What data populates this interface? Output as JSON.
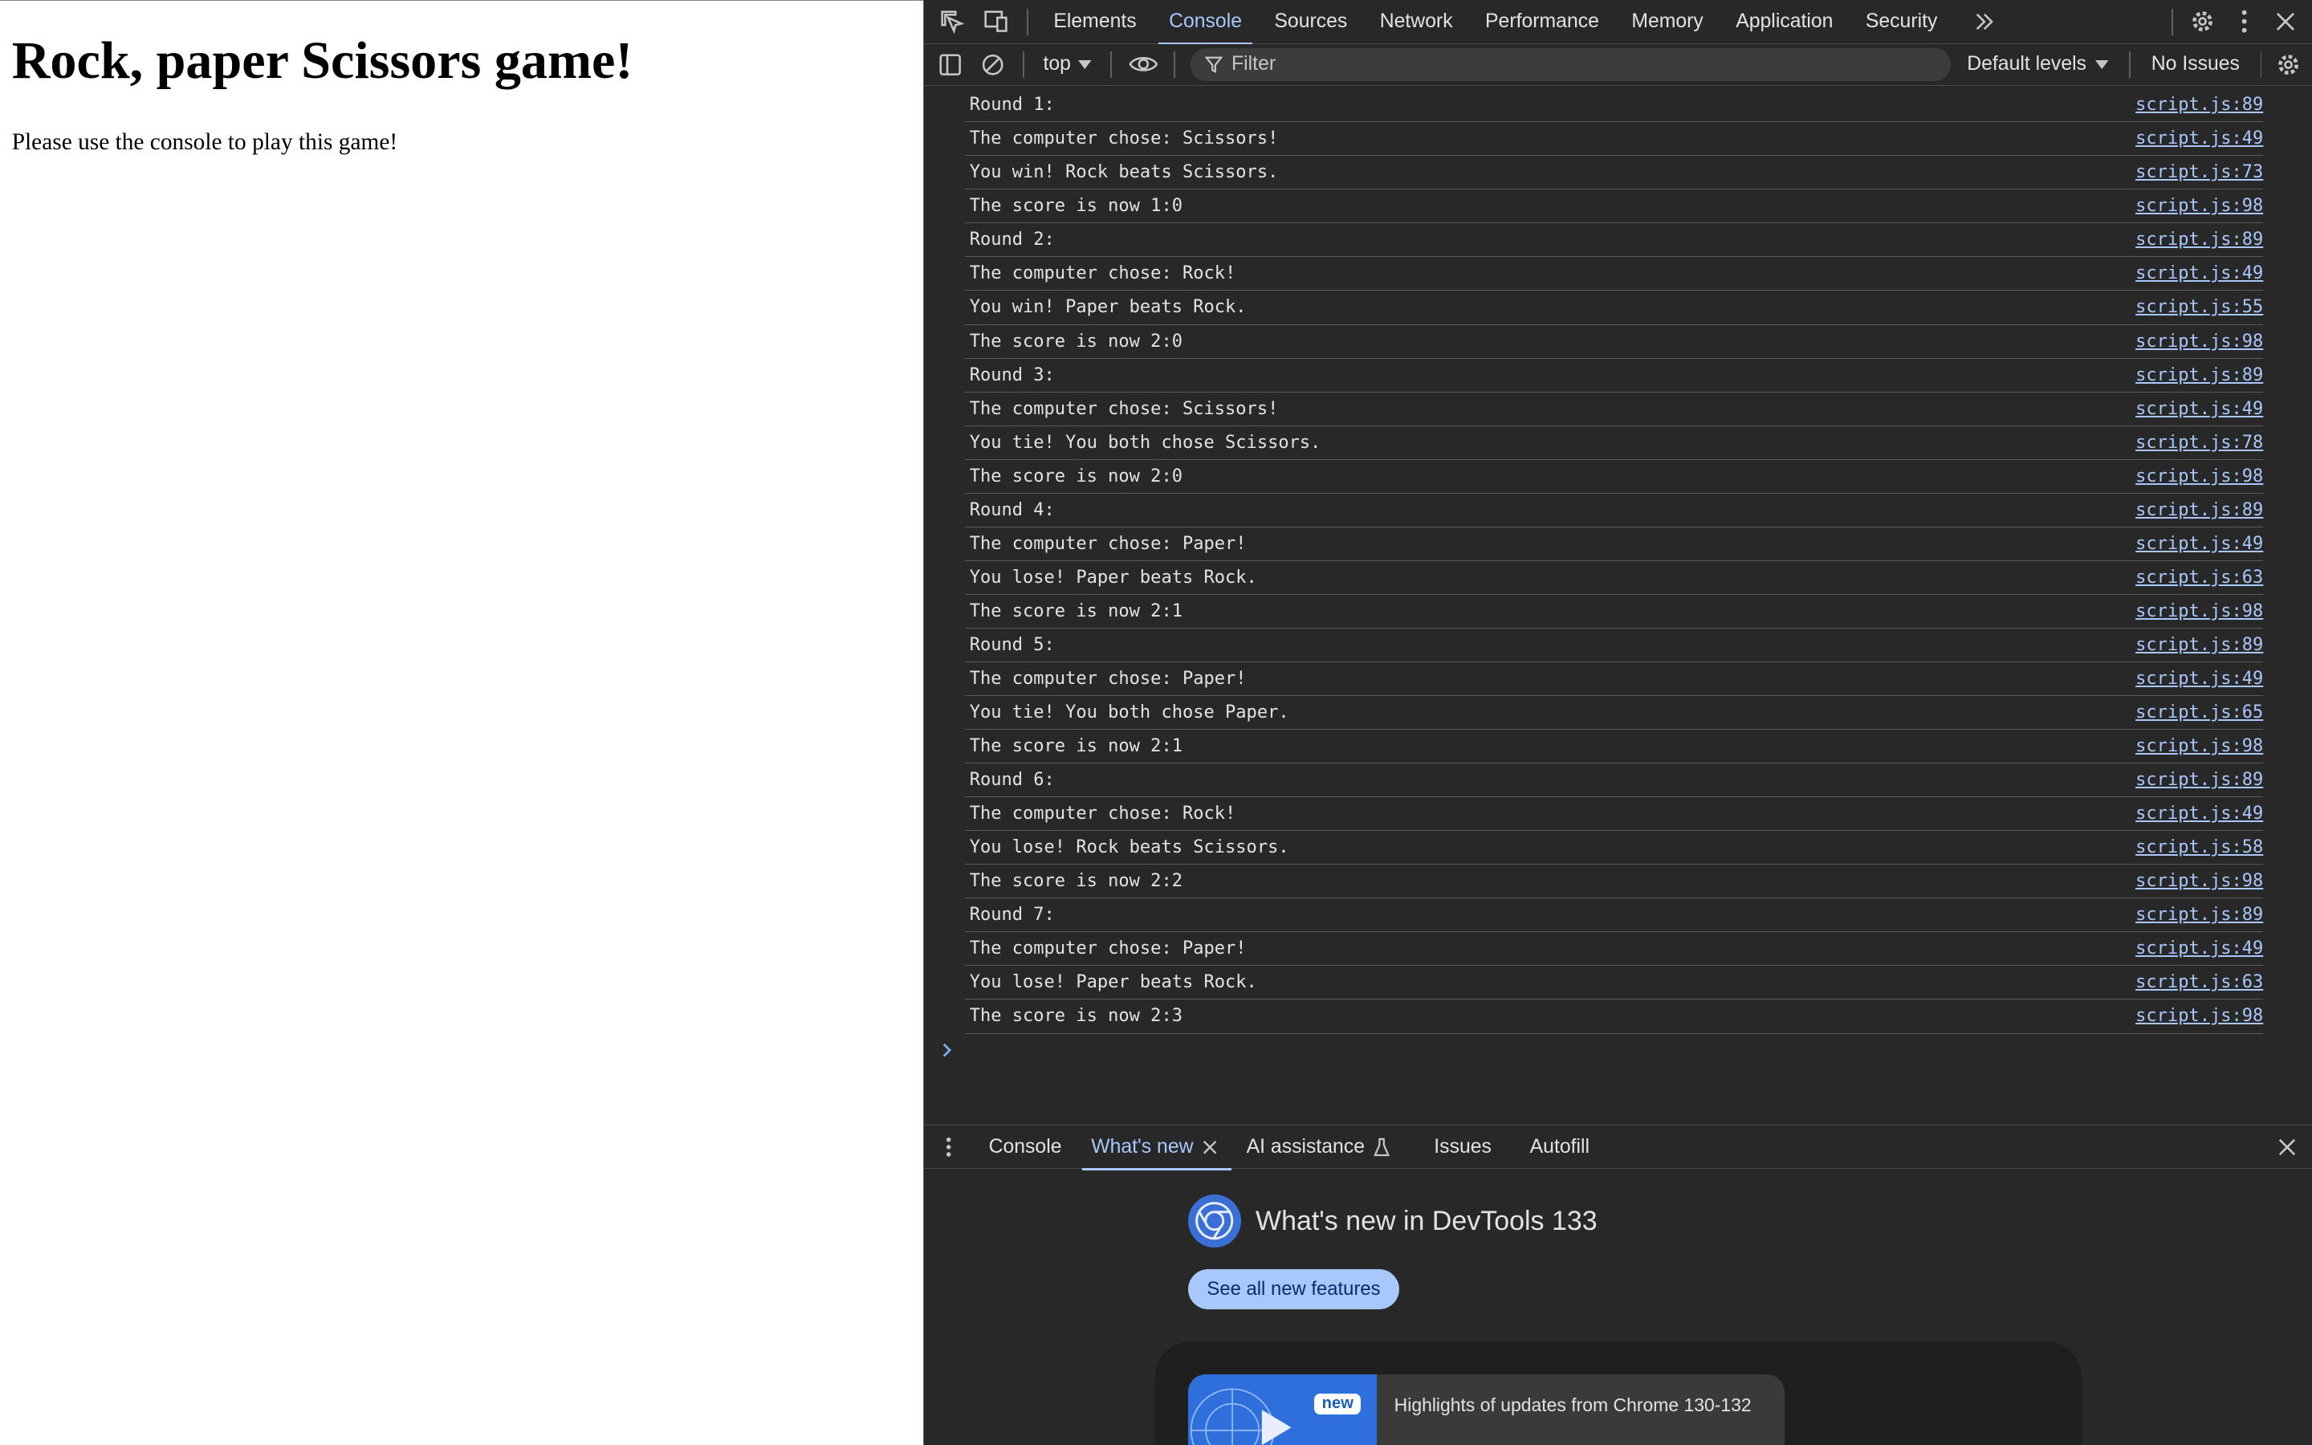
{
  "page": {
    "heading": "Rock, paper Scissors game!",
    "paragraph": "Please use the console to play this game!"
  },
  "devtools": {
    "tabs": [
      {
        "label": "Elements"
      },
      {
        "label": "Console"
      },
      {
        "label": "Sources"
      },
      {
        "label": "Network"
      },
      {
        "label": "Performance"
      },
      {
        "label": "Memory"
      },
      {
        "label": "Application"
      },
      {
        "label": "Security"
      }
    ],
    "active_tab": "Console",
    "toolbar": {
      "context": "top",
      "filter_placeholder": "Filter",
      "levels": "Default levels",
      "issues": "No Issues"
    },
    "console": [
      {
        "msg": "Round 1:",
        "src": "script.js:89"
      },
      {
        "msg": "The computer chose: Scissors!",
        "src": "script.js:49"
      },
      {
        "msg": "You win! Rock beats Scissors.",
        "src": "script.js:73"
      },
      {
        "msg": "The score is now 1:0",
        "src": "script.js:98"
      },
      {
        "msg": "Round 2:",
        "src": "script.js:89"
      },
      {
        "msg": "The computer chose: Rock!",
        "src": "script.js:49"
      },
      {
        "msg": "You win! Paper beats Rock.",
        "src": "script.js:55"
      },
      {
        "msg": "The score is now 2:0",
        "src": "script.js:98"
      },
      {
        "msg": "Round 3:",
        "src": "script.js:89"
      },
      {
        "msg": "The computer chose: Scissors!",
        "src": "script.js:49"
      },
      {
        "msg": "You tie! You both chose Scissors.",
        "src": "script.js:78"
      },
      {
        "msg": "The score is now 2:0",
        "src": "script.js:98"
      },
      {
        "msg": "Round 4:",
        "src": "script.js:89"
      },
      {
        "msg": "The computer chose: Paper!",
        "src": "script.js:49"
      },
      {
        "msg": "You lose! Paper beats Rock.",
        "src": "script.js:63"
      },
      {
        "msg": "The score is now 2:1",
        "src": "script.js:98"
      },
      {
        "msg": "Round 5:",
        "src": "script.js:89"
      },
      {
        "msg": "The computer chose: Paper!",
        "src": "script.js:49"
      },
      {
        "msg": "You tie! You both chose Paper.",
        "src": "script.js:65"
      },
      {
        "msg": "The score is now 2:1",
        "src": "script.js:98"
      },
      {
        "msg": "Round 6:",
        "src": "script.js:89"
      },
      {
        "msg": "The computer chose: Rock!",
        "src": "script.js:49"
      },
      {
        "msg": "You lose! Rock beats Scissors.",
        "src": "script.js:58"
      },
      {
        "msg": "The score is now 2:2",
        "src": "script.js:98"
      },
      {
        "msg": "Round 7:",
        "src": "script.js:89"
      },
      {
        "msg": "The computer chose: Paper!",
        "src": "script.js:49"
      },
      {
        "msg": "You lose! Paper beats Rock.",
        "src": "script.js:63"
      },
      {
        "msg": "The score is now 2:3",
        "src": "script.js:98"
      }
    ],
    "drawer": {
      "tabs": [
        {
          "label": "Console"
        },
        {
          "label": "What's new"
        },
        {
          "label": "AI assistance"
        },
        {
          "label": "Issues"
        },
        {
          "label": "Autofill"
        }
      ],
      "active_tab": "What's new",
      "whats_new": {
        "title": "What's new in DevTools 133",
        "button": "See all new features",
        "badge": "new",
        "item": "Highlights of updates from Chrome 130-132"
      }
    },
    "colors": {
      "accent": "#a8c7fa",
      "background": "#282828",
      "text": "#e3e3e3"
    }
  }
}
